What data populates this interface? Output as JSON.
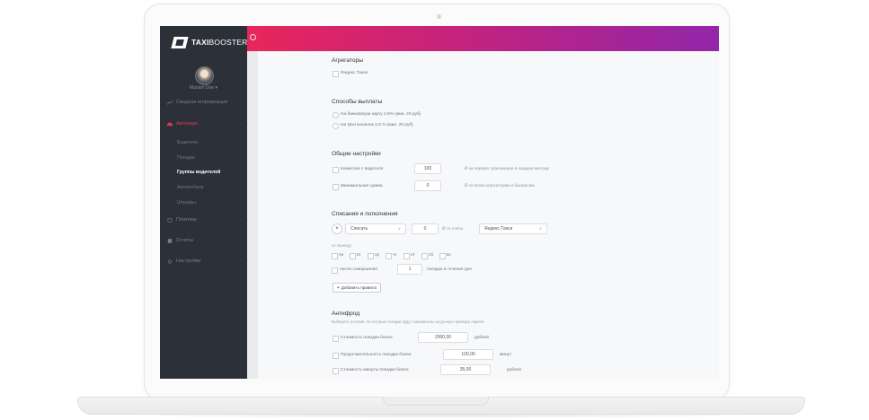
{
  "brand": {
    "logo_main": "TAXI",
    "logo_thin": "BOOSTER."
  },
  "user": {
    "name": "Mariam Doe ▾"
  },
  "sidebar": {
    "items": [
      {
        "label": "Сводная информация"
      },
      {
        "label": "Автопарк",
        "active": true
      },
      {
        "label": "Платежи"
      },
      {
        "label": "Отчеты"
      },
      {
        "label": "Настройки"
      }
    ],
    "subitems": [
      {
        "label": "Водители"
      },
      {
        "label": "Поездки"
      },
      {
        "label": "Группы водителей",
        "current": true
      },
      {
        "label": "Автомобили"
      },
      {
        "label": "Штрафы"
      }
    ]
  },
  "colors": {
    "gradient_start": "#e8265a",
    "gradient_end": "#9226a9",
    "sidebar_bg": "#2c3038",
    "active": "#e2345a"
  },
  "aggregators": {
    "title": "Агрегаторы",
    "option": "Яндекс.Такси"
  },
  "payout": {
    "title": "Способы выплаты",
    "options": [
      "На банковскую карту 2,5% (мин. 20 руб)",
      "На Qiwi кошелек 2,5 % (мин. 20 руб)"
    ]
  },
  "general": {
    "title": "Общие настройки",
    "commission_label": "Комиссия с водителя",
    "commission_value": "100",
    "commission_note": "₽ за первую транзакцию в каждом месяце",
    "min_sum_label": "Минимальная сумма",
    "min_sum_value": "0",
    "min_sum_note": "₽ по всем агрегаторам и балансам"
  },
  "charges": {
    "title": "Списания и пополнения",
    "remove_symbol": "×",
    "action_select": "Списать",
    "amount": "0",
    "from_account": "₽ со счета",
    "account_select": "Яндекс.Такси",
    "period_label": "по периоду",
    "days": [
      "пн",
      "вт",
      "ср",
      "чт",
      "пт",
      "сб",
      "вс"
    ],
    "after_label": "после совершения",
    "after_value": "1",
    "after_note": "поездок в течение дня",
    "add_rule": "Добавить правило",
    "add_icon": "+"
  },
  "antifraud": {
    "title": "Антифрод",
    "subtitle": "Выберите условия, по которым поездки будут направлены на ручную проверку парком",
    "rules": [
      {
        "label": "Стоимость поездки более",
        "value": "2000,00",
        "unit": "рублей"
      },
      {
        "label": "Продолжительность поездки более",
        "value": "100,00",
        "unit": "минут"
      },
      {
        "label": "Стоимость минуты поездки более",
        "value": "35,00",
        "unit": "рублей"
      }
    ]
  }
}
